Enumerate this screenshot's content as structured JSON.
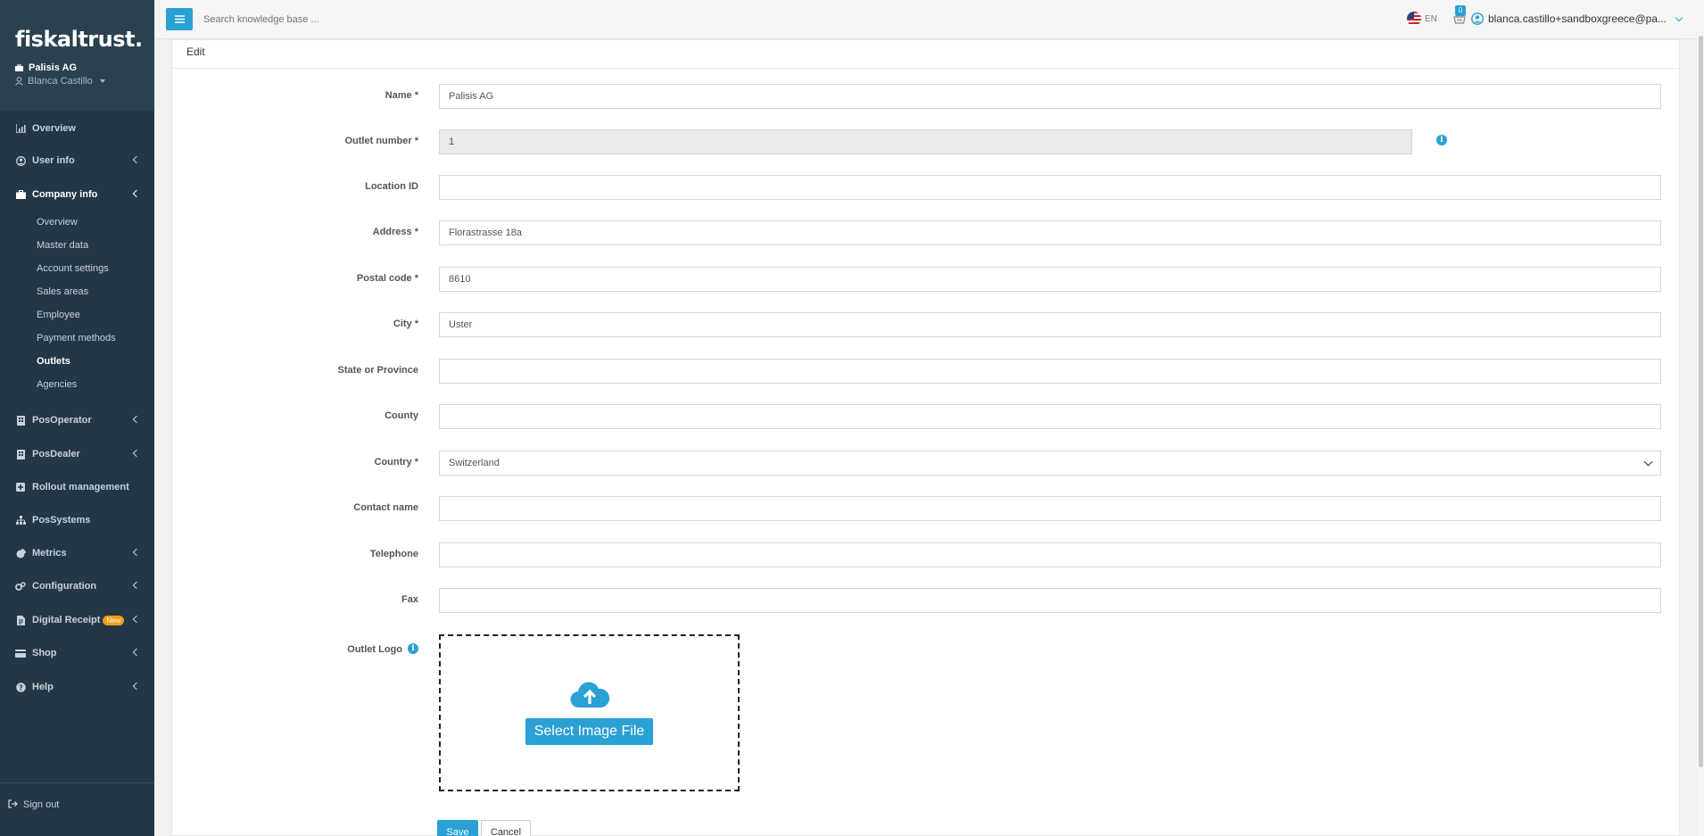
{
  "sidebar": {
    "logo": "fiskaltrust.",
    "company": "Palisis AG",
    "user": "Blanca Castillo",
    "nav": [
      {
        "label": "Overview",
        "icon": "chart-icon"
      },
      {
        "label": "User info",
        "icon": "user-circle-icon"
      },
      {
        "label": "Company info",
        "icon": "briefcase-icon"
      },
      {
        "label": "PosOperator",
        "icon": "building-icon"
      },
      {
        "label": "PosDealer",
        "icon": "building-icon"
      },
      {
        "label": "Rollout management",
        "icon": "plus-square-icon"
      },
      {
        "label": "PosSystems",
        "icon": "sitemap-icon"
      },
      {
        "label": "Metrics",
        "icon": "pie-chart-icon"
      },
      {
        "label": "Configuration",
        "icon": "cogs-icon"
      },
      {
        "label": "Digital Receipt",
        "icon": "receipt-icon",
        "badge": "New"
      },
      {
        "label": "Shop",
        "icon": "credit-card-icon"
      },
      {
        "label": "Help",
        "icon": "question-icon"
      }
    ],
    "company_sub": [
      "Overview",
      "Master data",
      "Account settings",
      "Sales areas",
      "Employee",
      "Payment methods",
      "Outlets",
      "Agencies"
    ],
    "signout": "Sign out"
  },
  "topbar": {
    "search_placeholder": "Search knowledge base ...",
    "lang": "EN",
    "cart_count": "0",
    "user_email": "blanca.castillo+sandboxgreece@pa..."
  },
  "form": {
    "header": "Edit",
    "name_label": "Name *",
    "name_value": "Palisis AG",
    "outlet_number_label": "Outlet number *",
    "outlet_number_value": "1",
    "location_label": "Location ID",
    "location_value": "",
    "address_label": "Address *",
    "address_value": "Florastrasse 18a",
    "postal_label": "Postal code *",
    "postal_value": "8610",
    "city_label": "City *",
    "city_value": "Uster",
    "state_label": "State or Province",
    "state_value": "",
    "county_label": "County",
    "county_value": "",
    "country_label": "Country *",
    "country_value": "Switzerland",
    "contact_label": "Contact name",
    "contact_value": "",
    "telephone_label": "Telephone",
    "telephone_value": "",
    "fax_label": "Fax",
    "fax_value": "",
    "logo_label": "Outlet Logo",
    "select_image": "Select Image File",
    "save": "Save",
    "cancel": "Cancel"
  },
  "colors": {
    "sidebar_bg": "#243746",
    "accent": "#2aa0d4",
    "badge_new": "#f39c12"
  }
}
